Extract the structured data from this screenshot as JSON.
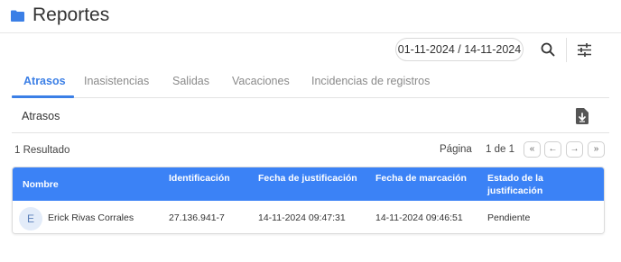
{
  "header": {
    "title": "Reportes",
    "icon": "folder-icon",
    "accent_color": "#3b7fe6"
  },
  "toolbar": {
    "date_range": "01-11-2024 / 14-11-2024",
    "search_icon": "search-icon",
    "filter_icon": "sliders-icon"
  },
  "tabs": [
    {
      "label": "Atrasos",
      "active": true
    },
    {
      "label": "Inasistencias",
      "active": false
    },
    {
      "label": "Salidas",
      "active": false
    },
    {
      "label": "Vacaciones",
      "active": false
    },
    {
      "label": "Incidencias de registros",
      "active": false
    }
  ],
  "section": {
    "title": "Atrasos",
    "download_icon": "file-download-icon"
  },
  "results": {
    "count_text": "1 Resultado",
    "page_label": "Página",
    "page_value": "1 de 1",
    "first": "«",
    "prev": "←",
    "next": "→",
    "last": "»"
  },
  "table": {
    "header_color": "#3b82f6",
    "columns": [
      "Nombre",
      "Identificación",
      "Fecha de justificación",
      "Fecha de marcación",
      "Estado de la justificación"
    ],
    "rows": [
      {
        "avatar": "E",
        "nombre": "Erick Rivas Corrales",
        "identificacion": "27.136.941-7",
        "fecha_justificacion": "14-11-2024 09:47:31",
        "fecha_marcacion": "14-11-2024 09:46:51",
        "estado": "Pendiente"
      }
    ]
  }
}
